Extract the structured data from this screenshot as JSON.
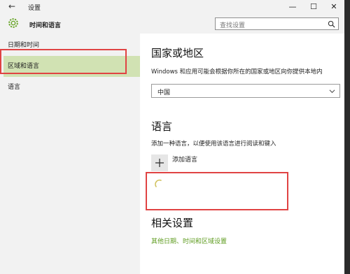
{
  "window": {
    "title": "设置",
    "back_icon": "arrow-left-icon",
    "controls": [
      "—",
      "☐",
      "✕"
    ]
  },
  "header": {
    "icon": "gear-icon",
    "title": "时间和语言",
    "search": {
      "placeholder": "查找设置",
      "icon": "search-icon"
    }
  },
  "sidebar": {
    "items": [
      {
        "label": "日期和时间",
        "selected": false
      },
      {
        "label": "区域和语言",
        "selected": true
      },
      {
        "label": "语言",
        "selected": false
      }
    ]
  },
  "region": {
    "heading": "国家或地区",
    "description": "Windows 和应用可能会根据你所在的国家或地区向你提供本地内",
    "country_value": "中国"
  },
  "language": {
    "heading": "语言",
    "description": "添加一种语言，以便使用该语言进行阅读和键入",
    "add_label": "添加语言"
  },
  "related": {
    "heading": "相关设置",
    "link": "其他日期、时间和区域设置"
  },
  "colors": {
    "accent_green": "#5d9b1e",
    "selected_bg": "#d1e2b3",
    "annotation_red": "#e04343"
  }
}
